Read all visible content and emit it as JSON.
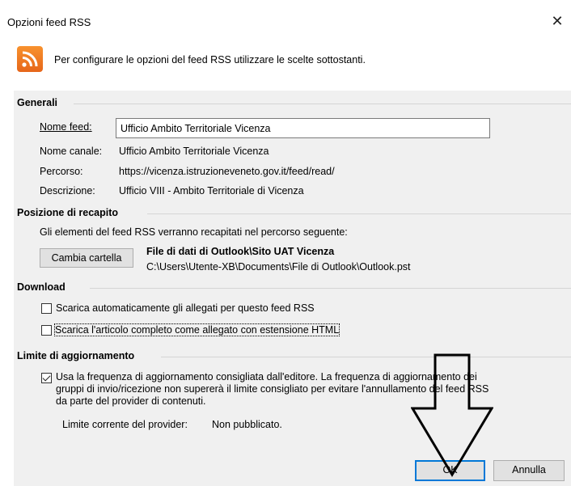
{
  "dialog": {
    "title": "Opzioni feed RSS",
    "close_glyph": "✕",
    "header_text": "Per configurare le opzioni del feed RSS utilizzare le scelte sottostanti.",
    "header_icon": "rss-icon",
    "accent_color": "#0078d7",
    "icon_color": "#f07d24"
  },
  "generali": {
    "heading": "Generali",
    "feed_name_label": "Nome feed:",
    "feed_name_value": "Ufficio Ambito Territoriale Vicenza",
    "channel_label": "Nome canale:",
    "channel_value": "Ufficio Ambito Territoriale Vicenza",
    "path_label": "Percorso:",
    "path_value": "https://vicenza.istruzioneveneto.gov.it/feed/read/",
    "desc_label": "Descrizione:",
    "desc_value": "Ufficio VIII - Ambito Territoriale di Vicenza"
  },
  "delivery": {
    "heading": "Posizione di recapito",
    "intro": "Gli elementi del feed RSS verranno recapitati nel percorso seguente:",
    "change_button": "Cambia cartella",
    "folder_name": "File di dati di Outlook\\Sito UAT Vicenza",
    "folder_path": "C:\\Users\\Utente-XB\\Documents\\File di Outlook\\Outlook.pst"
  },
  "download": {
    "heading": "Download",
    "auto_attachments": {
      "label": "Scarica automaticamente gli allegati per questo feed RSS",
      "checked": false
    },
    "full_article": {
      "label": "Scarica l'articolo completo come allegato con estensione HTML",
      "checked": false
    }
  },
  "update_limit": {
    "heading": "Limite di aggiornamento",
    "use_publisher": {
      "checked": true,
      "line1": "Usa la frequenza di aggiornamento consigliata dall'editore. La frequenza di aggiornamento dei",
      "line2": "gruppi di invio/ricezione non supererà il limite consigliato per evitare l'annullamento del feed RSS",
      "line3": "da parte del provider di contenuti."
    },
    "provider_label": "Limite corrente del provider:",
    "provider_value": "Non pubblicato."
  },
  "footer": {
    "ok": "OK",
    "cancel": "Annulla"
  }
}
